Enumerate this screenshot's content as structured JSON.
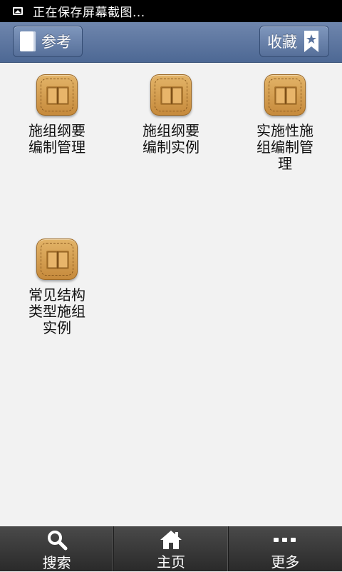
{
  "statusbar": {
    "icon": "image-icon",
    "text": "正在保存屏幕截图..."
  },
  "titlebar": {
    "left_button": {
      "label": "参考",
      "icon": "book-icon"
    },
    "right_button": {
      "label": "收藏",
      "icon": "bookmark-star-icon"
    }
  },
  "items": [
    {
      "label": "施组纲要编制管理",
      "icon": "open-book-icon"
    },
    {
      "label": "施组纲要编制实例",
      "icon": "open-book-icon"
    },
    {
      "label": "实施性施组编制管理",
      "icon": "open-book-icon"
    },
    {
      "label": "常见结构类型施组实例",
      "icon": "open-book-icon"
    }
  ],
  "bottombar": {
    "tabs": [
      {
        "label": "搜索",
        "icon": "search-icon"
      },
      {
        "label": "主页",
        "icon": "home-icon"
      },
      {
        "label": "更多",
        "icon": "more-dots-icon"
      }
    ]
  },
  "colors": {
    "titlebar": "#5a739e",
    "background": "#f2f2f2",
    "icon_gold": "#d29c4f",
    "bottombar": "#333333"
  }
}
